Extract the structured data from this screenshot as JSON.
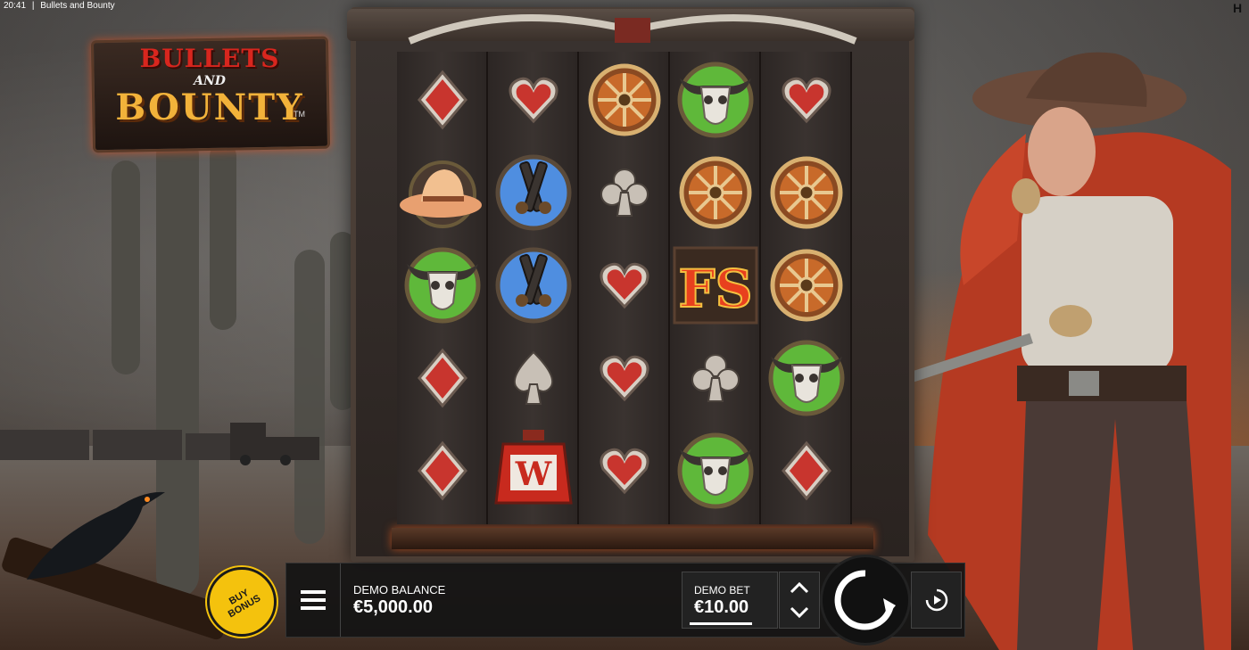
{
  "system": {
    "time": "20:41",
    "separator": "|",
    "window_title": "Bullets and Bounty"
  },
  "logo": {
    "line1": "BULLETS",
    "line2": "AND",
    "line3": "BOUNTY",
    "tm": "TM"
  },
  "reels": [
    [
      "diamond-card",
      "cowboy-hat",
      "bull-skull",
      "diamond-card",
      "diamond-card"
    ],
    [
      "heart-card",
      "crossed-revolvers",
      "crossed-revolvers",
      "spade-card",
      "wild-lantern"
    ],
    [
      "wagon-wheel",
      "club-card",
      "heart-card",
      "heart-card",
      "heart-card"
    ],
    [
      "bull-skull",
      "wagon-wheel",
      "free-spins",
      "club-card",
      "bull-skull"
    ],
    [
      "heart-card",
      "wagon-wheel",
      "wagon-wheel",
      "bull-skull",
      "diamond-card"
    ]
  ],
  "symbols": {
    "free_spins_text": "FS",
    "wild_text": "W"
  },
  "controls": {
    "buy_bonus_label": "BUY BONUS",
    "balance_label": "DEMO BALANCE",
    "balance_value": "€5,000.00",
    "bet_label": "DEMO BET",
    "bet_value": "€10.00"
  },
  "colors": {
    "accent_yellow": "#f4c20d",
    "card_red": "#c8352e",
    "bar_bg": "#141414"
  }
}
